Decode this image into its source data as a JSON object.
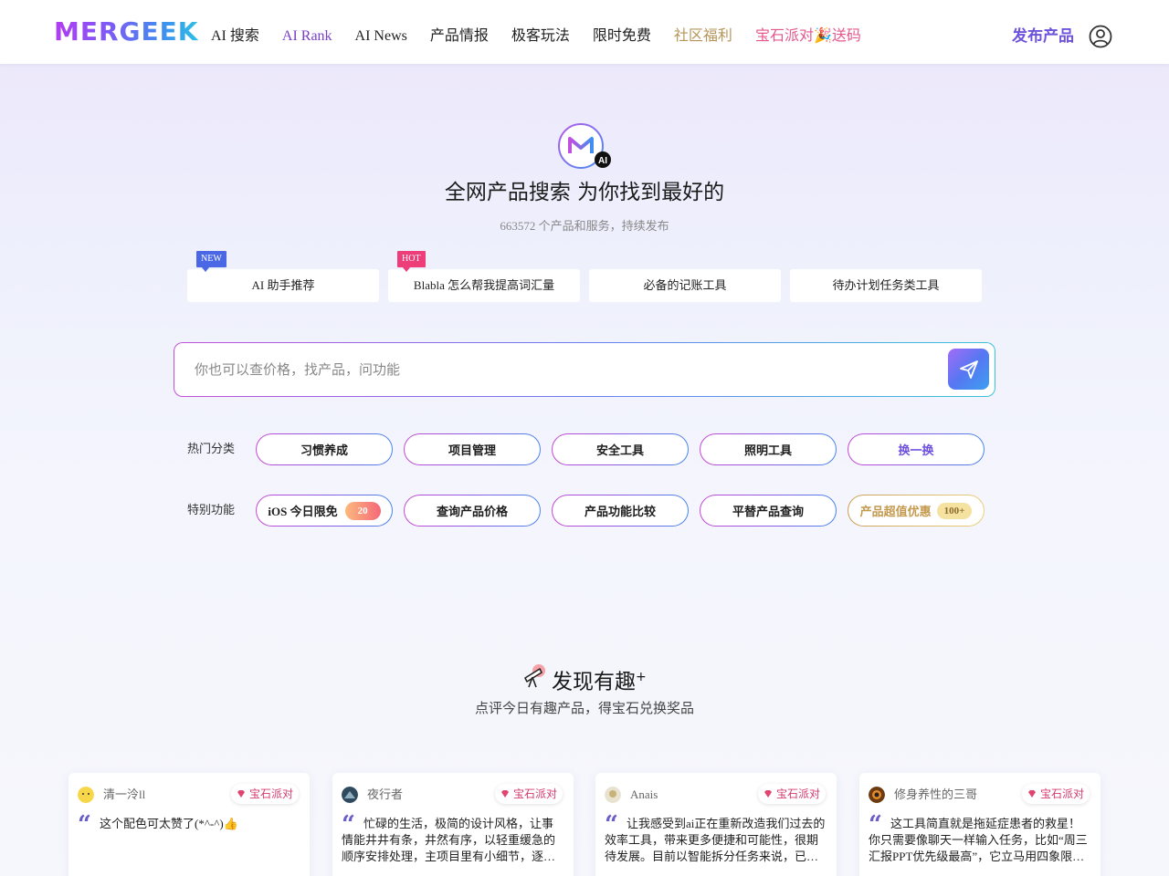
{
  "header": {
    "logo": "MERGEEK",
    "nav": [
      {
        "label": "AI 搜索",
        "style": "normal"
      },
      {
        "label": "AI Rank",
        "style": "purple"
      },
      {
        "label": "AI News",
        "style": "normal"
      },
      {
        "label": "产品情报",
        "style": "normal"
      },
      {
        "label": "极客玩法",
        "style": "normal"
      },
      {
        "label": "限时免费",
        "style": "normal"
      },
      {
        "label": "社区福利",
        "style": "gold"
      },
      {
        "label": "宝石派对🎉送码",
        "style": "pink"
      }
    ],
    "publish_label": "发布产品"
  },
  "hero": {
    "badge": "AI",
    "title": "全网产品搜索 为你找到最好的",
    "subtitle": "663572 个产品和服务，持续发布"
  },
  "suggestions": [
    {
      "label": "AI 助手推荐",
      "tag": "NEW"
    },
    {
      "label": "Blabla 怎么帮我提高词汇量",
      "tag": "HOT"
    },
    {
      "label": "必备的记账工具",
      "tag": ""
    },
    {
      "label": "待办计划任务类工具",
      "tag": ""
    }
  ],
  "search": {
    "placeholder": "你也可以查价格，找产品，问功能"
  },
  "categories": {
    "label": "热门分类",
    "items": [
      "习惯养成",
      "项目管理",
      "安全工具",
      "照明工具"
    ],
    "refresh_label": "换一换"
  },
  "features": {
    "label": "特别功能",
    "ios_label": "iOS 今日限免",
    "ios_count": "20",
    "items": [
      "查询产品价格",
      "产品功能比较",
      "平替产品查询"
    ],
    "deal_label": "产品超值优惠",
    "deal_count": "100+"
  },
  "discover": {
    "title": "发现有趣",
    "title_sup": "+",
    "subtitle": "点评今日有趣产品，得宝石兑换奖品",
    "cards": [
      {
        "user": "清一泠ll",
        "badge": "宝石派对",
        "text": "这个配色可太赞了(*^-^)👍",
        "avatar_color": "#f7d64a"
      },
      {
        "user": "夜行者",
        "badge": "宝石派对",
        "text": "忙碌的生活，极简的设计风格，让事情能井井有条，井然有序，以轻重缓急的顺序安排处理，主项目里有小细节，逐一落实即完成一个个任务。",
        "avatar_color": "#2f4a5c"
      },
      {
        "user": "Anais",
        "badge": "宝石派对",
        "text": "让我感受到ai正在重新改造我们过去的效率工具，带来更多便捷和可能性，很期待发展。目前以智能拆分任务来说，已经带来帮助。",
        "avatar_color": "#e8e2d0"
      },
      {
        "user": "修身养性的三哥",
        "badge": "宝石派对",
        "text": "这工具简直就是拖延症患者的救星！你只需要像聊天一样输入任务，比如“周三汇报PPT优先级最高”，它立马用四象限法则自动分类。",
        "avatar_color": "#6b3b12"
      }
    ]
  },
  "colors": {
    "accent_purple": "#6d53dc",
    "gold": "#b69558",
    "pink": "#e5578c",
    "new_tag": "#4a68e6",
    "hot_tag": "#ee3e7a"
  }
}
